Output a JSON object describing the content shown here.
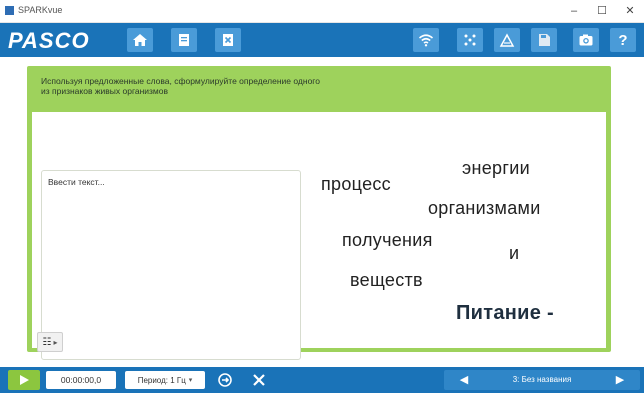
{
  "window": {
    "title": "SPARKvue",
    "minimize": "–",
    "maximize": "☐",
    "close": "✕"
  },
  "toolbar": {
    "logo": "PASCO",
    "left_buttons": [
      "home-icon",
      "page-icon",
      "close-doc-icon"
    ],
    "right_buttons": [
      "wifi-icon",
      "sensors-icon",
      "shape-icon",
      "save-icon",
      "camera-icon",
      "help-icon"
    ],
    "help_label": "?"
  },
  "content": {
    "prompt": "Используя предложенные слова, сформулируйте определение одного из признаков живых организмов",
    "textbox_placeholder": "Ввести текст...",
    "words": {
      "w1": "энергии",
      "w2": "процесс",
      "w3": "организмами",
      "w4": "получения",
      "w5": "и",
      "w6": "веществ",
      "w7": "Питание -"
    }
  },
  "bottombar": {
    "time": "00:00:00,0",
    "period": "Период: 1 Гц",
    "page_label": "3: Без названия"
  },
  "colors": {
    "toolbar_blue": "#1a73b8",
    "accent_green": "#9ed25c",
    "play_green": "#8cc63f"
  }
}
